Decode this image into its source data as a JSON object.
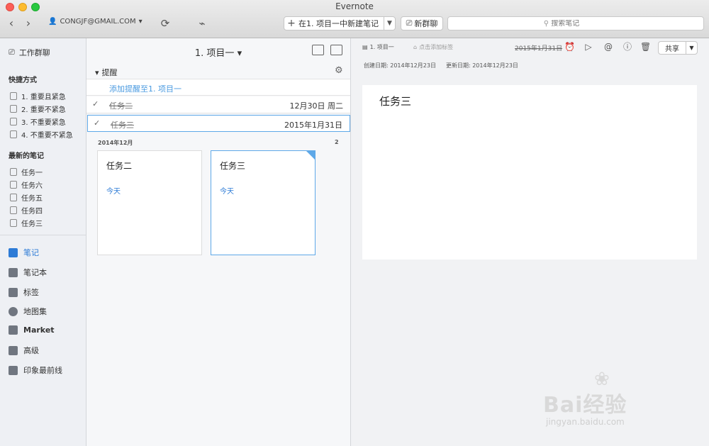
{
  "window": {
    "title": "Evernote"
  },
  "toolbar": {
    "account": "CONGJF@GMAIL.COM",
    "new_note_label": "在1. 项目一中新建笔记",
    "new_chat_label": "新群聊",
    "search_placeholder": "搜索笔记"
  },
  "sidebar": {
    "work_chat": "工作群聊",
    "shortcuts_head": "快捷方式",
    "shortcuts": [
      "1. 重要且紧急",
      "2. 重要不紧急",
      "3. 不重要紧急",
      "4. 不重要不紧急"
    ],
    "recent_head": "最新的笔记",
    "recent": [
      "任务一",
      "任务六",
      "任务五",
      "任务四",
      "任务三"
    ],
    "main": [
      "笔记",
      "笔记本",
      "标签",
      "地图集",
      "Market",
      "高级",
      "印象最前线"
    ]
  },
  "notelist": {
    "title": "1. 项目一",
    "reminders_head": "提醒",
    "add_reminder": "添加提醒至1. 项目一",
    "reminders": [
      {
        "name": "任务二",
        "date": "12月30日 周二"
      },
      {
        "name": "任务三",
        "date": "2015年1月31日"
      }
    ],
    "section_label": "2014年12月",
    "section_count": "2",
    "cards": [
      {
        "title": "任务二",
        "date": "今天"
      },
      {
        "title": "任务三",
        "date": "今天"
      }
    ]
  },
  "editor": {
    "notebook": "1. 项目一",
    "tag_placeholder": "点击添加标签",
    "reminder_date": "2015年1月31日",
    "share_label": "共享",
    "created": "创建日期: 2014年12月23日",
    "updated": "更新日期: 2014年12月23日",
    "note_title": "任务三"
  },
  "watermark": {
    "brand": "Bai经验",
    "url": "jingyan.baidu.com"
  }
}
